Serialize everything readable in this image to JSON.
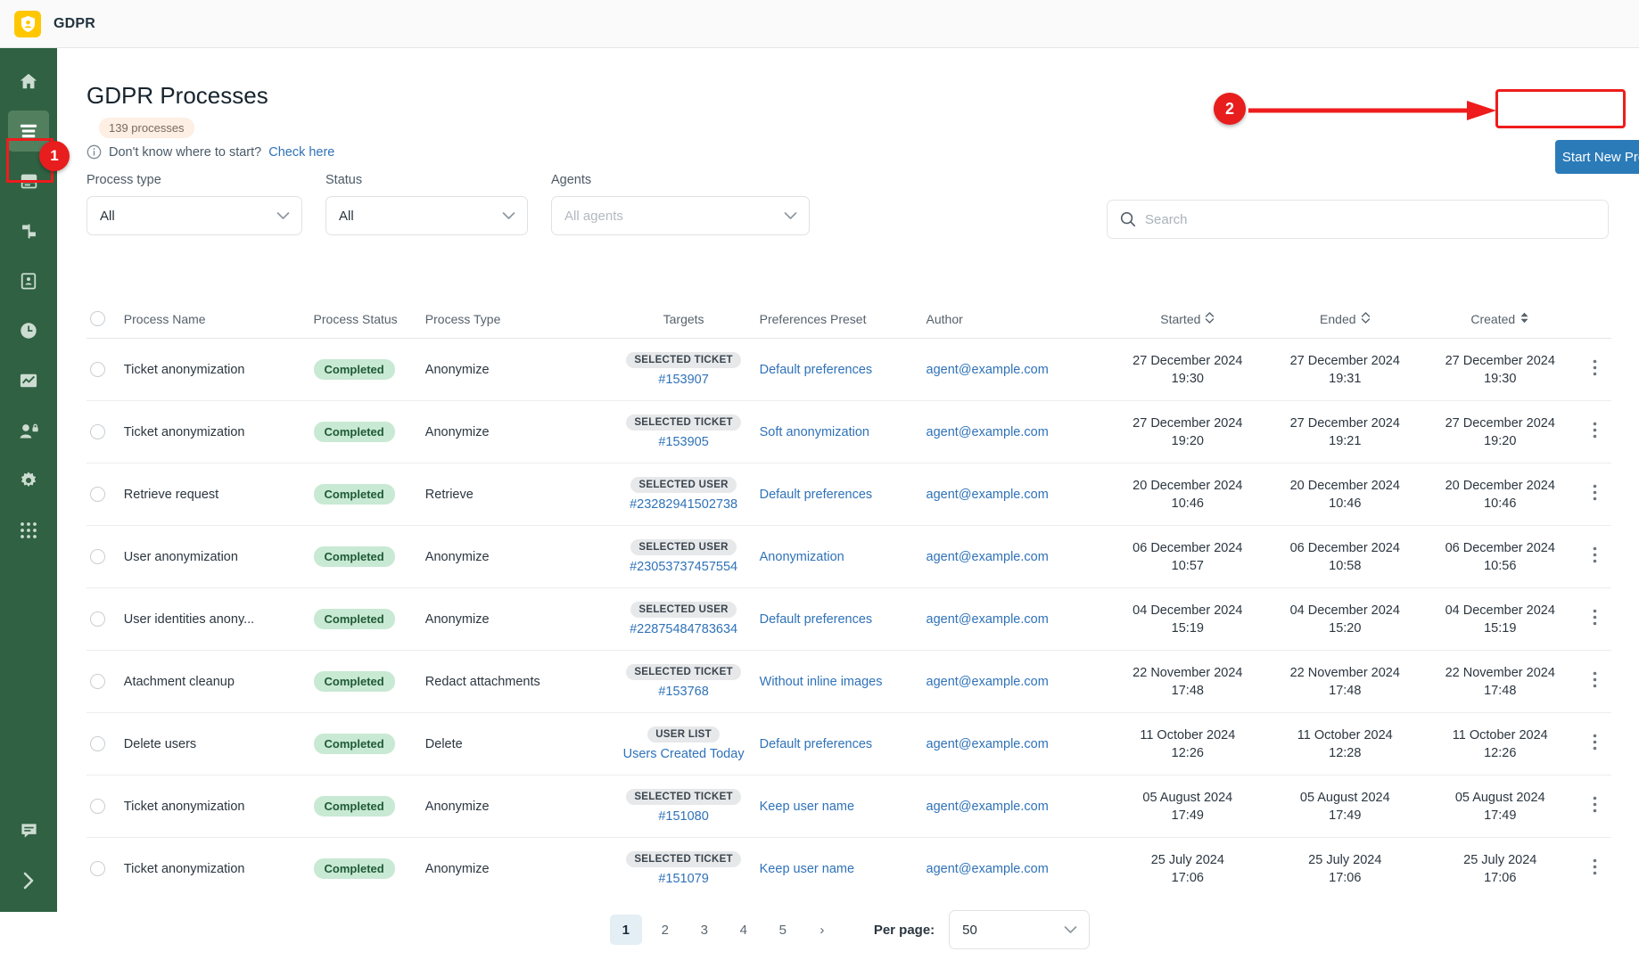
{
  "topbar": {
    "app_title": "GDPR",
    "logo_icon": "gdpr-shield-logo"
  },
  "sidebar": {
    "items": [
      {
        "icon": "home-icon",
        "name": "home"
      },
      {
        "icon": "list-lines-icon",
        "name": "processes"
      },
      {
        "icon": "server-icon",
        "name": "data-sources"
      },
      {
        "icon": "flow-icon",
        "name": "workflows"
      },
      {
        "icon": "clipboard-icon",
        "name": "requests"
      },
      {
        "icon": "clock-icon",
        "name": "history"
      },
      {
        "icon": "chart-icon",
        "name": "reports"
      },
      {
        "icon": "user-lock-icon",
        "name": "permissions"
      },
      {
        "icon": "gear-icon",
        "name": "settings"
      },
      {
        "icon": "grid-apps-icon",
        "name": "apps"
      }
    ],
    "bottom_items": [
      {
        "icon": "chat-icon",
        "name": "support-chat"
      },
      {
        "icon": "chevron-right-icon",
        "name": "expand-sidebar"
      }
    ]
  },
  "header": {
    "title": "GDPR Processes",
    "count_pill": "139 processes",
    "hint_text": "Don't know where to start?",
    "hint_link": "Check here",
    "start_button": "Start New Process"
  },
  "filters": [
    {
      "label": "Process type",
      "value": "All",
      "placeholder": false
    },
    {
      "label": "Status",
      "value": "All",
      "placeholder": false
    },
    {
      "label": "Agents",
      "value": "All agents",
      "placeholder": true
    }
  ],
  "search": {
    "placeholder": "Search",
    "value": ""
  },
  "table": {
    "columns": [
      {
        "key": "name",
        "label": "Process Name",
        "sortable": false
      },
      {
        "key": "status",
        "label": "Process Status",
        "sortable": false
      },
      {
        "key": "type",
        "label": "Process Type",
        "sortable": false
      },
      {
        "key": "target",
        "label": "Targets",
        "sortable": false
      },
      {
        "key": "pref",
        "label": "Preferences Preset",
        "sortable": false
      },
      {
        "key": "author",
        "label": "Author",
        "sortable": false
      },
      {
        "key": "started",
        "label": "Started",
        "sortable": true,
        "sort_state": "none"
      },
      {
        "key": "ended",
        "label": "Ended",
        "sortable": true,
        "sort_state": "none"
      },
      {
        "key": "created",
        "label": "Created",
        "sortable": true,
        "sort_state": "active"
      }
    ],
    "rows": [
      {
        "name": "Ticket anonymization",
        "status": "Completed",
        "type": "Anonymize",
        "target_tag": "SELECTED TICKET",
        "target_value": "#153907",
        "pref": "Default preferences",
        "author": "agent@example.com",
        "started_date": "27 December 2024",
        "started_time": "19:30",
        "ended_date": "27 December 2024",
        "ended_time": "19:31",
        "created_date": "27 December 2024",
        "created_time": "19:30"
      },
      {
        "name": "Ticket anonymization",
        "status": "Completed",
        "type": "Anonymize",
        "target_tag": "SELECTED TICKET",
        "target_value": "#153905",
        "pref": "Soft anonymization",
        "author": "agent@example.com",
        "started_date": "27 December 2024",
        "started_time": "19:20",
        "ended_date": "27 December 2024",
        "ended_time": "19:21",
        "created_date": "27 December 2024",
        "created_time": "19:20"
      },
      {
        "name": "Retrieve request",
        "status": "Completed",
        "type": "Retrieve",
        "target_tag": "SELECTED USER",
        "target_value": "#23282941502738",
        "pref": "Default preferences",
        "author": "agent@example.com",
        "started_date": "20 December 2024",
        "started_time": "10:46",
        "ended_date": "20 December 2024",
        "ended_time": "10:46",
        "created_date": "20 December 2024",
        "created_time": "10:46"
      },
      {
        "name": "User anonymization",
        "status": "Completed",
        "type": "Anonymize",
        "target_tag": "SELECTED USER",
        "target_value": "#23053737457554",
        "pref": "Anonymization",
        "author": "agent@example.com",
        "started_date": "06 December 2024",
        "started_time": "10:57",
        "ended_date": "06 December 2024",
        "ended_time": "10:58",
        "created_date": "06 December 2024",
        "created_time": "10:56"
      },
      {
        "name": "User identities anony...",
        "status": "Completed",
        "type": "Anonymize",
        "target_tag": "SELECTED USER",
        "target_value": "#22875484783634",
        "pref": "Default preferences",
        "author": "agent@example.com",
        "started_date": "04 December 2024",
        "started_time": "15:19",
        "ended_date": "04 December 2024",
        "ended_time": "15:20",
        "created_date": "04 December 2024",
        "created_time": "15:19"
      },
      {
        "name": "Atachment cleanup",
        "status": "Completed",
        "type": "Redact attachments",
        "target_tag": "SELECTED TICKET",
        "target_value": "#153768",
        "pref": "Without inline images",
        "author": "agent@example.com",
        "started_date": "22 November 2024",
        "started_time": "17:48",
        "ended_date": "22 November 2024",
        "ended_time": "17:48",
        "created_date": "22 November 2024",
        "created_time": "17:48"
      },
      {
        "name": "Delete users",
        "status": "Completed",
        "type": "Delete",
        "target_tag": "USER LIST",
        "target_value": "Users Created Today",
        "pref": "Default preferences",
        "author": "agent@example.com",
        "started_date": "11 October 2024",
        "started_time": "12:26",
        "ended_date": "11 October 2024",
        "ended_time": "12:28",
        "created_date": "11 October 2024",
        "created_time": "12:26"
      },
      {
        "name": "Ticket anonymization",
        "status": "Completed",
        "type": "Anonymize",
        "target_tag": "SELECTED TICKET",
        "target_value": "#151080",
        "pref": "Keep user name",
        "author": "agent@example.com",
        "started_date": "05 August 2024",
        "started_time": "17:49",
        "ended_date": "05 August 2024",
        "ended_time": "17:49",
        "created_date": "05 August 2024",
        "created_time": "17:49"
      },
      {
        "name": "Ticket anonymization",
        "status": "Completed",
        "type": "Anonymize",
        "target_tag": "SELECTED TICKET",
        "target_value": "#151079",
        "pref": "Keep user name",
        "author": "agent@example.com",
        "started_date": "25 July 2024",
        "started_time": "17:06",
        "ended_date": "25 July 2024",
        "ended_time": "17:06",
        "created_date": "25 July 2024",
        "created_time": "17:06"
      }
    ]
  },
  "pagination": {
    "pages": [
      "1",
      "2",
      "3",
      "4",
      "5"
    ],
    "current": "1",
    "next_arrow": "›",
    "per_page_label": "Per page:",
    "per_page_value": "50"
  },
  "annotations": [
    {
      "id": "1",
      "label": "1",
      "target": "sidebar-processes"
    },
    {
      "id": "2",
      "label": "2",
      "target": "start-new-process-button"
    }
  ],
  "colors": {
    "sidebar_bg": "#2f6142",
    "accent_blue": "#2b7bb9",
    "link_blue": "#2f72b8",
    "badge_green_bg": "#c8e9d3",
    "badge_green_fg": "#1f5a36",
    "annotation_red": "#ee1c1c",
    "logo_yellow": "#ffc700"
  }
}
